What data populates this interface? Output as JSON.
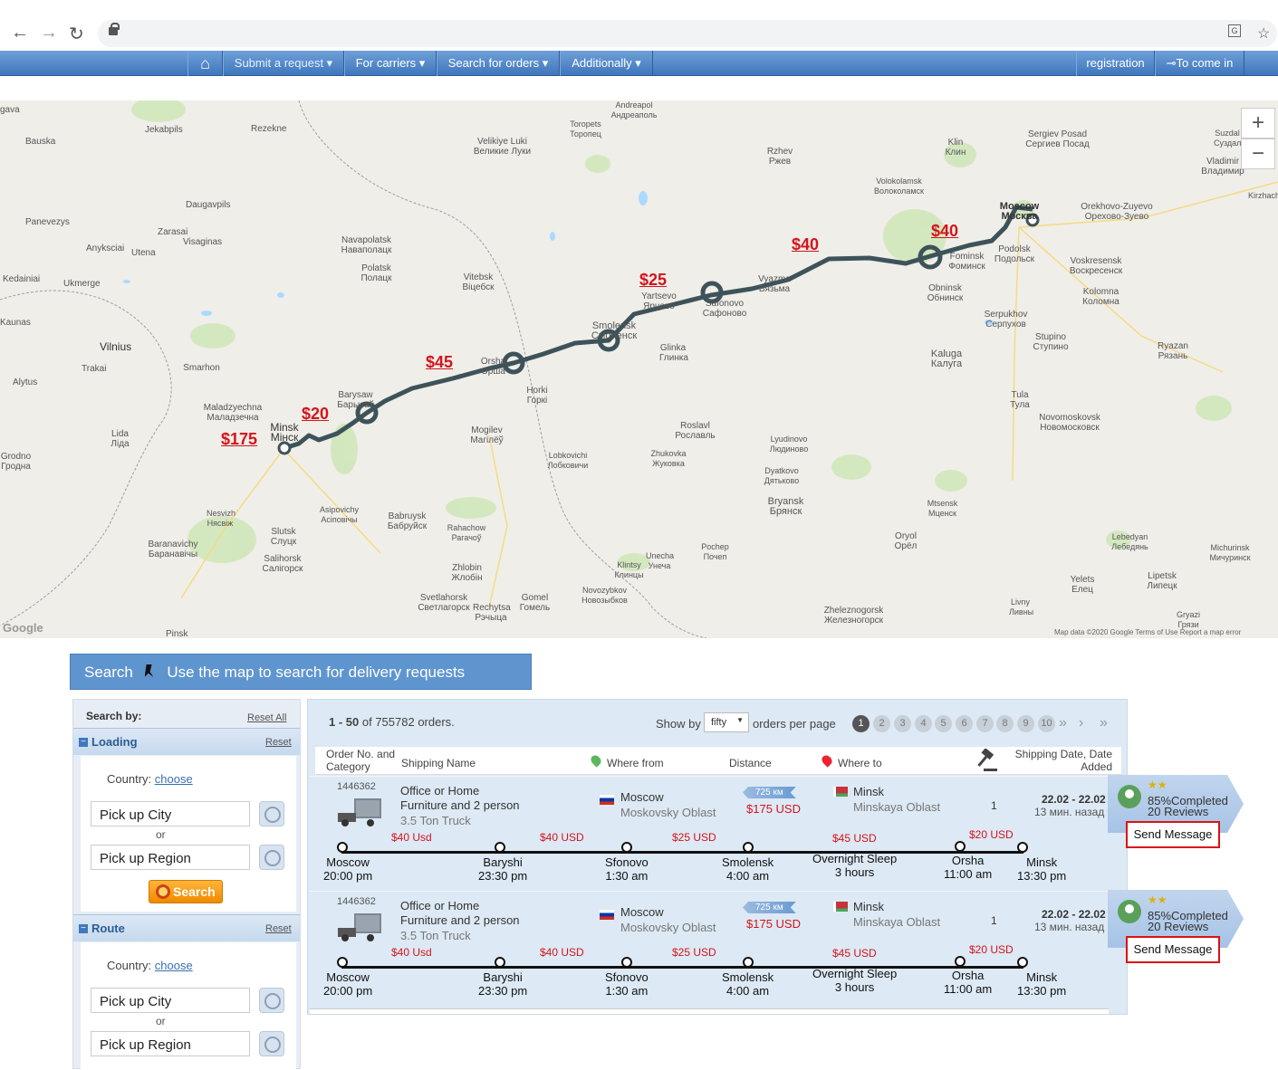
{
  "browser": {
    "back": "←",
    "forward": "→",
    "reload": "↻",
    "translate_icon": "translate-icon",
    "star_icon": "☆"
  },
  "menu": {
    "home_icon": "⌂",
    "items": [
      "Submit a request ▾",
      "For carriers ▾",
      "Search for orders ▾",
      "Additionally ▾"
    ],
    "registration": "registration",
    "login": "⊸To come in"
  },
  "map": {
    "zoom_in": "+",
    "zoom_out": "−",
    "prices": [
      "$175",
      "$20",
      "$45",
      "$25",
      "$40",
      "$40"
    ],
    "cities": [
      "gava",
      "Bauska",
      "Jekabpils",
      "Rezekne",
      "Daugavpils",
      "Panevezys",
      "Zarasai",
      "Visaginas",
      "Anyksciai",
      "Utena",
      "Kedainiai",
      "Ukmerge",
      "Kaunas",
      "Vilnius",
      "Trakai",
      "Alytus",
      "Smarhon",
      "Maladzyechna Маладзечна",
      "Navapolatsk Наваполацк",
      "Polatsk Полацк",
      "Velikiye Luki Великие Луки",
      "Toropets Торопец",
      "Andreapol Андреаполь",
      "Rzhev Ржев",
      "Vitebsk Віцебск",
      "Volokolamsk Волоколамск",
      "Klin Клин",
      "Sergiev Posad Сергиев Посад",
      "Vladimir Владимир",
      "Moscow Москва",
      "Orekhovo-Zuyevo Орехово-Зуево",
      "Podolsk Подольск",
      "Fominsk Фоминск",
      "Voskresensk Воскресенск",
      "Kolomna Коломна",
      "Obninsk Обнинск",
      "Vyazma Вязьма",
      "Yartsevo Ярцево",
      "Safonovo Сафоново",
      "Smolensk Смоленск",
      "Orsha Орша",
      "Barysaw Барысаў",
      "Minsk Мінск",
      "Horki Горкі",
      "Glinka Глинка",
      "Roslavl Рославль",
      "Serpukhov Серпухов",
      "Kaluga Калуга",
      "Stupino Ступино",
      "Ryazan Рязань",
      "Tula Тула",
      "Novomoskovsk Новомосковск",
      "Mogilev Магілёў",
      "Lida Ліда",
      "Grodno Гродна",
      "Asipovichy Асіповічы",
      "Babruysk Бабруйск",
      "Slutsk Слуцк",
      "Salihorsk Салігорск",
      "Baranavichy Баранавічы",
      "Nesvizh Нясвіж",
      "Rahachow Рагачоў",
      "Zhlobin Жлобін",
      "Svetlahorsk Светлагорск",
      "Rechytsa Рэчыца",
      "Gomel Гомель",
      "Pinsk",
      "Lobkovichi Лобковичи",
      "Zhukovka Жуковка",
      "Bryansk Брянск",
      "Lyudinovo Людиново",
      "Dyatkovo Дятьково",
      "Mtsensk Мценск",
      "Oryol Орёл",
      "Klintsy Клинцы",
      "Unecha Унеча",
      "Pochep Почеп",
      "Novozybkov Новозыбков",
      "Zheleznogorsk Железногорск",
      "Livny Ливны",
      "Yelets Елец",
      "Lipetsk Липецк",
      "Lebedyan Лебедянь",
      "Michurinsk Мичуринск",
      "Gryazi Грязи",
      "Suzdal Суздаль",
      "Kirzhach"
    ],
    "google": "Google",
    "footer": "Map data ©2020 Google    Terms of Use    Report a map error"
  },
  "banner": {
    "search": "Search",
    "pin_icon": "pin-icon",
    "text": "Use the map to search for delivery requests"
  },
  "sidebar": {
    "search_by": "Search by:",
    "reset_all": "Reset All",
    "loading": {
      "title": "Loading",
      "reset": "Reset",
      "country_label": "Country:",
      "country_value": "choose",
      "city": "Pick up City",
      "or": "or",
      "region": "Pick up Region",
      "search": "Search"
    },
    "route": {
      "title": "Route",
      "reset": "Reset",
      "country_label": "Country:",
      "country_value": "choose",
      "city": "Pick up City",
      "or": "or",
      "region": "Pick up Region"
    }
  },
  "results": {
    "range": "1 - 50",
    "of": "of 755782 orders.",
    "show_by": "Show by",
    "per_page_value": "fifty",
    "per_page": "orders per page",
    "pages": [
      "1",
      "2",
      "3",
      "4",
      "5",
      "6",
      "7",
      "8",
      "9",
      "10"
    ],
    "next": "»",
    "next2": "›",
    "last": "»",
    "columns": {
      "order": "Order No. and Category",
      "shipping": "Shipping Name",
      "from": "Where from",
      "distance": "Distance",
      "to": "Where to",
      "date": "Shipping Date, Date Added"
    },
    "orders": [
      {
        "id": "1446362",
        "name": [
          "Office or Home",
          "Furniture and 2 person"
        ],
        "truck": "3.5 Ton Truck",
        "from_city": "Moscow",
        "from_region": "Moskovsky Oblast",
        "distance": "725 км",
        "price": "$175 USD",
        "to_city": "Minsk",
        "to_region": "Minskaya Oblast",
        "bids": "1",
        "date": "22.02 - 22.02",
        "added": "13 мин. назад",
        "rating_pct": "85%",
        "completed": "Completed",
        "reviews": "20 Reviews",
        "send": "Send Message",
        "segments": [
          "$40 Usd",
          "$40 USD",
          "$25 USD",
          "$45 USD",
          "$20 USD"
        ],
        "stops": [
          {
            "name": "Moscow",
            "time": "20:00 pm"
          },
          {
            "name": "Baryshi",
            "time": "23:30 pm"
          },
          {
            "name": "Sfonovo",
            "time": "1:30 am"
          },
          {
            "name": "Smolensk",
            "time": "4:00 am"
          },
          {
            "name": "Overnight Sleep",
            "time": "3 hours"
          },
          {
            "name": "Orsha",
            "time": "11:00 am"
          },
          {
            "name": "Minsk",
            "time": "13:30 pm"
          }
        ]
      },
      {
        "id": "1446362",
        "name": [
          "Office or Home",
          "Furniture and 2 person"
        ],
        "truck": "3.5 Ton Truck",
        "from_city": "Moscow",
        "from_region": "Moskovsky Oblast",
        "distance": "725 км",
        "price": "$175 USD",
        "to_city": "Minsk",
        "to_region": "Minskaya Oblast",
        "bids": "1",
        "date": "22.02 - 22.02",
        "added": "13 мин. назад",
        "rating_pct": "85%",
        "completed": "Completed",
        "reviews": "20 Reviews",
        "send": "Send Message",
        "segments": [
          "$40 Usd",
          "$40 USD",
          "$25 USD",
          "$45 USD",
          "$20 USD"
        ],
        "stops": [
          {
            "name": "Moscow",
            "time": "20:00 pm"
          },
          {
            "name": "Baryshi",
            "time": "23:30 pm"
          },
          {
            "name": "Sfonovo",
            "time": "1:30 am"
          },
          {
            "name": "Smolensk",
            "time": "4:00 am"
          },
          {
            "name": "Overnight Sleep",
            "time": "3 hours"
          },
          {
            "name": "Orsha",
            "time": "11:00 am"
          },
          {
            "name": "Minsk",
            "time": "13:30 pm"
          }
        ]
      }
    ]
  },
  "colors": {
    "menu": "#3f76bc",
    "price_red": "#d4141c",
    "route": "#3d5359",
    "banner": "#5f95cf",
    "search_orange": "#f59a17"
  }
}
